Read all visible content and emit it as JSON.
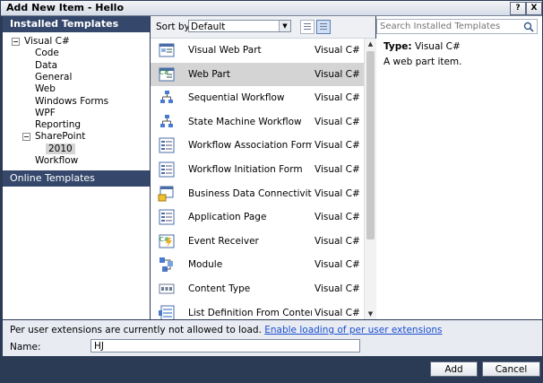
{
  "window": {
    "title": "Add New Item - Hello",
    "help_label": "?",
    "close_label": "X"
  },
  "left": {
    "installed_header": "Installed Templates",
    "tree": [
      {
        "label": "Visual C#",
        "level": 0,
        "expander": true
      },
      {
        "label": "Code",
        "level": 1
      },
      {
        "label": "Data",
        "level": 1
      },
      {
        "label": "General",
        "level": 1
      },
      {
        "label": "Web",
        "level": 1
      },
      {
        "label": "Windows Forms",
        "level": 1
      },
      {
        "label": "WPF",
        "level": 1
      },
      {
        "label": "Reporting",
        "level": 1
      },
      {
        "label": "SharePoint",
        "level": 1,
        "expander": true
      },
      {
        "label": "2010",
        "level": 2,
        "selected": true
      },
      {
        "label": "Workflow",
        "level": 1
      }
    ],
    "online_templates": "Online Templates"
  },
  "sortbar": {
    "label": "Sort by:",
    "value": "Default"
  },
  "templates": [
    {
      "name": "Visual Web Part",
      "lang": "Visual C#",
      "icon": "visual-web-part-icon"
    },
    {
      "name": "Web Part",
      "lang": "Visual C#",
      "icon": "web-part-icon",
      "selected": true
    },
    {
      "name": "Sequential Workflow",
      "lang": "Visual C#",
      "icon": "workflow-icon"
    },
    {
      "name": "State Machine Workflow",
      "lang": "Visual C#",
      "icon": "workflow-icon"
    },
    {
      "name": "Workflow Association Form",
      "lang": "Visual C#",
      "icon": "form-icon"
    },
    {
      "name": "Workflow Initiation Form",
      "lang": "Visual C#",
      "icon": "form-icon"
    },
    {
      "name": "Business Data Connectivity Mo···",
      "lang": "Visual C#",
      "icon": "bdc-model-icon"
    },
    {
      "name": "Application Page",
      "lang": "Visual C#",
      "icon": "form-icon"
    },
    {
      "name": "Event Receiver",
      "lang": "Visual C#",
      "icon": "event-receiver-icon"
    },
    {
      "name": "Module",
      "lang": "Visual C#",
      "icon": "module-icon"
    },
    {
      "name": "Content Type",
      "lang": "Visual C#",
      "icon": "content-type-icon"
    },
    {
      "name": "List Definition From Content Type",
      "lang": "Visual C#",
      "icon": "list-definition-icon"
    }
  ],
  "right": {
    "search_placeholder": "Search Installed Templates",
    "type_label": "Type:",
    "type_value": "Visual C#",
    "description": "A web part item."
  },
  "bottom": {
    "message": "Per user extensions are currently not allowed to load.",
    "link": "Enable loading of per user extensions",
    "name_label": "Name:",
    "name_value": "HJ"
  },
  "buttons": {
    "add": "Add",
    "cancel": "Cancel"
  }
}
